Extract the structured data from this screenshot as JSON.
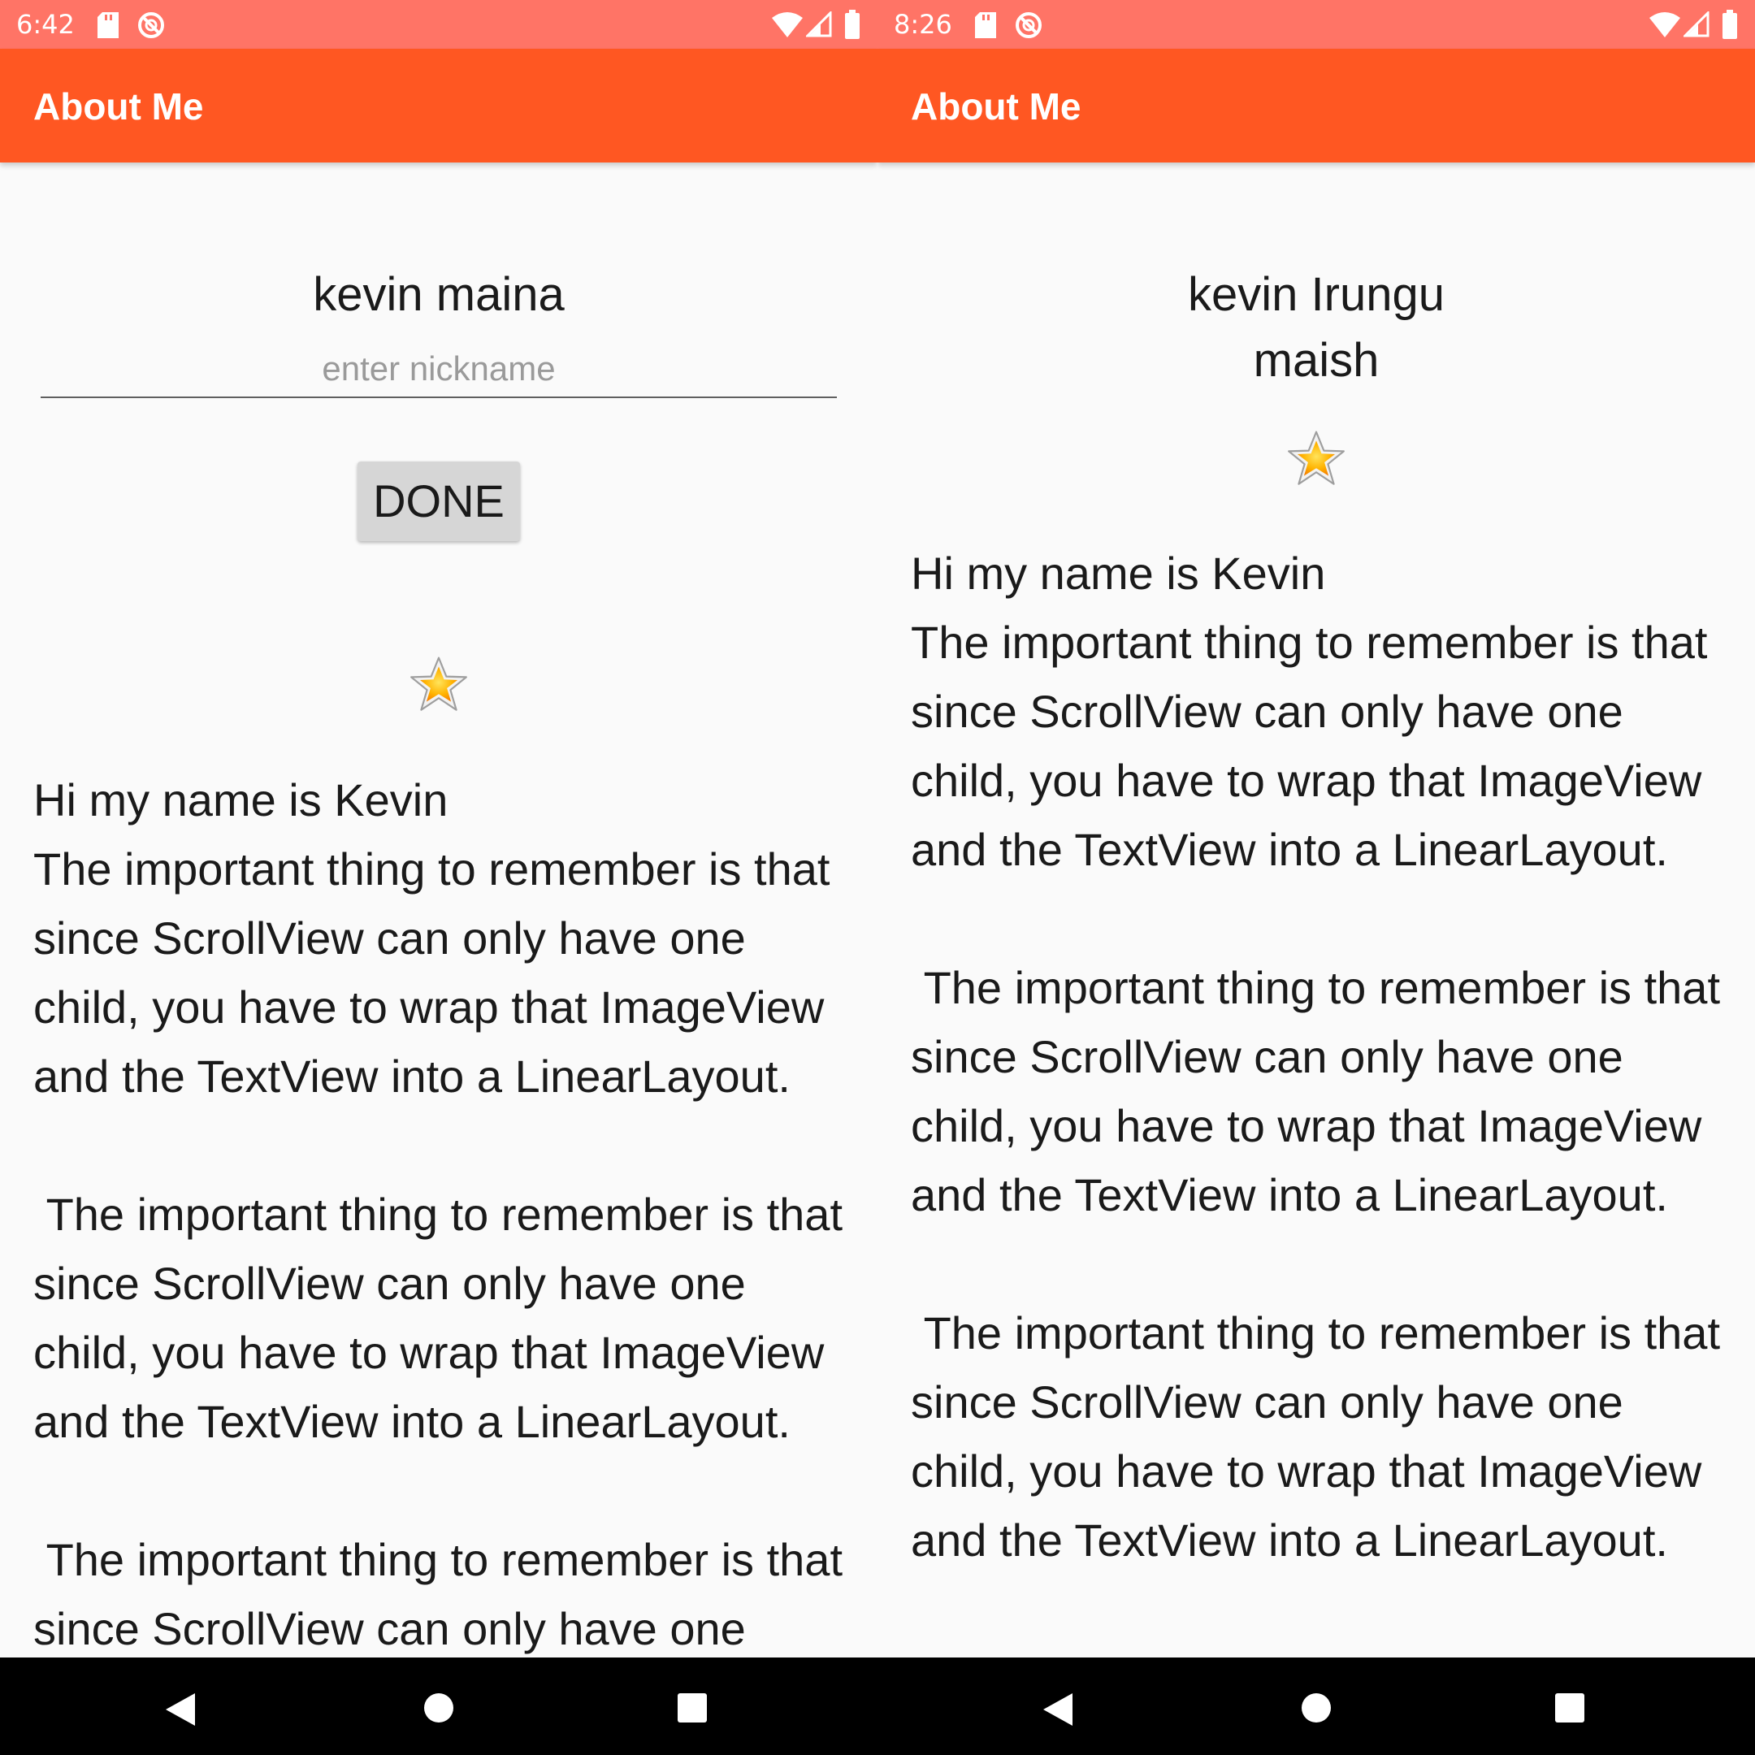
{
  "colors": {
    "status_bar": "#ff7466",
    "app_bar": "#ff5722",
    "background": "#fafafa",
    "nav_bar": "#000000",
    "button": "#d6d6d6"
  },
  "left_screen": {
    "status_bar": {
      "time": "6:42",
      "icons": [
        "sd-card-icon",
        "do-not-disturb-icon",
        "wifi-icon",
        "signal-icon",
        "battery-icon"
      ]
    },
    "app_bar": {
      "title": "About Me"
    },
    "name": "kevin maina",
    "nickname_input": {
      "value": "",
      "placeholder": "enter nickname"
    },
    "done_button": {
      "label": "DONE"
    },
    "star_icon": "star-icon",
    "bio": "Hi my name is Kevin\nThe important thing to remember is that since ScrollView can only have one child, you have to wrap that ImageView and the TextView into a LinearLayout.\n\n The important thing to remember is that since ScrollView can only have one child, you have to wrap that ImageView and the TextView into a LinearLayout.\n\n The important thing to remember is that since ScrollView can only have one child, you have to wrap that ImageView and the TextView into a LinearLayout.",
    "nav_bar": {
      "icons": [
        "back-icon",
        "home-icon",
        "recents-icon"
      ]
    }
  },
  "right_screen": {
    "status_bar": {
      "time": "8:26",
      "icons": [
        "sd-card-icon",
        "do-not-disturb-icon",
        "wifi-icon",
        "signal-icon",
        "battery-icon"
      ]
    },
    "app_bar": {
      "title": "About Me"
    },
    "name": "kevin Irungu",
    "nickname": "maish",
    "star_icon": "star-icon",
    "bio": "Hi my name is Kevin\nThe important thing to remember is that since ScrollView can only have one child, you have to wrap that ImageView and the TextView into a LinearLayout.\n\n The important thing to remember is that since ScrollView can only have one child, you have to wrap that ImageView and the TextView into a LinearLayout.\n\n The important thing to remember is that since ScrollView can only have one child, you have to wrap that ImageView and the TextView into a LinearLayout.",
    "nav_bar": {
      "icons": [
        "back-icon",
        "home-icon",
        "recents-icon"
      ]
    }
  }
}
